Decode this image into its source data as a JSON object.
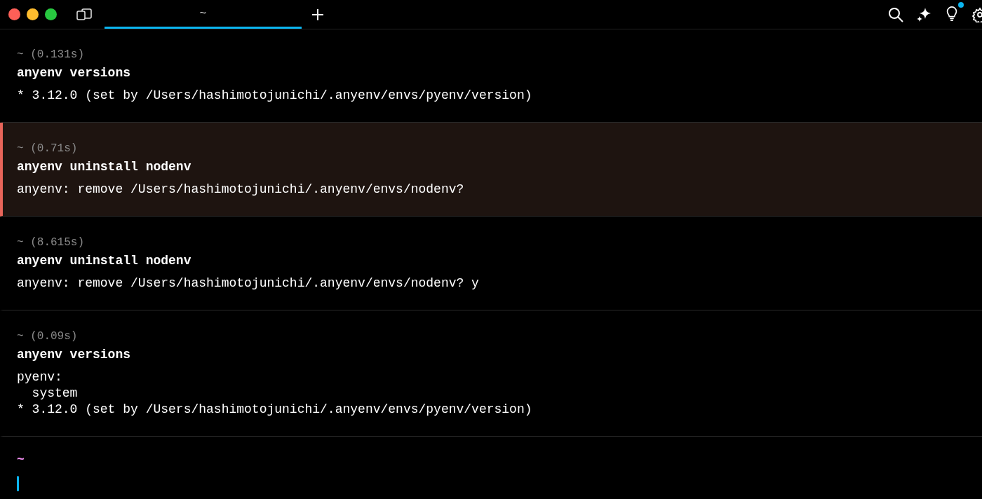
{
  "tabs": [
    {
      "label": "~",
      "selected": true
    }
  ],
  "toolbar": {
    "notification_dot": true
  },
  "blocks": [
    {
      "meta": "~ (0.131s)",
      "command": "anyenv versions",
      "error": false,
      "output": [
        "* 3.12.0 (set by /Users/hashimotojunichi/.anyenv/envs/pyenv/version)"
      ]
    },
    {
      "meta": "~ (0.71s)",
      "command": "anyenv uninstall nodenv",
      "error": true,
      "output": [
        "anyenv: remove /Users/hashimotojunichi/.anyenv/envs/nodenv?"
      ]
    },
    {
      "meta": "~ (8.615s)",
      "command": "anyenv uninstall nodenv",
      "error": false,
      "output": [
        "anyenv: remove /Users/hashimotojunichi/.anyenv/envs/nodenv? y"
      ]
    },
    {
      "meta": "~ (0.09s)",
      "command": "anyenv versions",
      "error": false,
      "output": [
        "pyenv:",
        "  system",
        "* 3.12.0 (set by /Users/hashimotojunichi/.anyenv/envs/pyenv/version)"
      ]
    }
  ],
  "prompt": {
    "path": "~"
  }
}
